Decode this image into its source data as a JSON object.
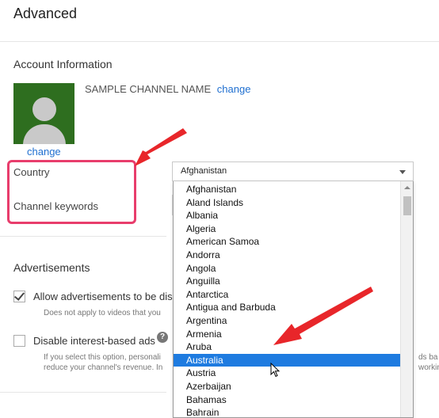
{
  "page": {
    "title": "Advanced"
  },
  "account": {
    "heading": "Account Information",
    "channel_name": "SAMPLE CHANNEL NAME",
    "change_label": "change",
    "avatar_change_label": "change",
    "country_label": "Country",
    "keywords_label": "Channel keywords",
    "country_selected": "Afghanistan"
  },
  "country_options": [
    "Afghanistan",
    "Aland Islands",
    "Albania",
    "Algeria",
    "American Samoa",
    "Andorra",
    "Angola",
    "Anguilla",
    "Antarctica",
    "Antigua and Barbuda",
    "Argentina",
    "Armenia",
    "Aruba",
    "Australia",
    "Austria",
    "Azerbaijan",
    "Bahamas",
    "Bahrain"
  ],
  "highlighted_option": "Australia",
  "ads": {
    "heading": "Advertisements",
    "allow_label": "Allow advertisements to be dis",
    "allow_checked": true,
    "allow_sub": "Does not apply to videos that you",
    "interest_label": "Disable interest-based ads",
    "interest_checked": false,
    "interest_sub1_left": "If you select this option, personali",
    "interest_sub2_left": "reduce your channel's revenue. In",
    "interest_sub1_right": "ds ba",
    "interest_sub2_right": "workin",
    "help_glyph": "?"
  },
  "colors": {
    "accent_link": "#1f6fd0",
    "highlight_red": "#e83d6c",
    "annotation_arrow": "#e8262a",
    "selected_option": "#1e7be0"
  },
  "icons": {
    "help": "help-icon",
    "dropdown": "caret-down-icon",
    "cursor": "mouse-pointer-icon",
    "avatar": "default-avatar-icon"
  }
}
